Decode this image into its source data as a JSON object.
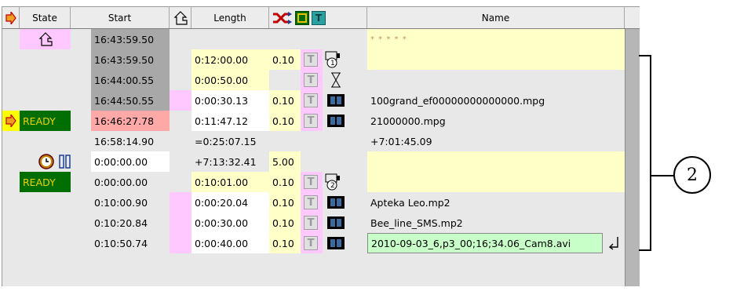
{
  "header": {
    "state": "State",
    "start": "Start",
    "length": "Length",
    "t_label": "T",
    "name": "Name"
  },
  "callout": {
    "label": "2"
  },
  "rows": [
    {
      "state": "",
      "start": "16:43:59.50",
      "length": "",
      "rate": "",
      "name": "* * * * *"
    },
    {
      "state": "",
      "start": "16:43:59.50",
      "length": "0:12:00.00",
      "rate": "0.10",
      "t": "T",
      "badge": "1",
      "name": ""
    },
    {
      "state": "",
      "start": "16:44:00.55",
      "length": "0:00:50.00",
      "rate": "",
      "t": "T",
      "name": ""
    },
    {
      "state": "",
      "start": "16:44:50.55",
      "length": "0:00:30.13",
      "rate": "0.10",
      "t": "T",
      "name": "100grand_ef00000000000000.mpg"
    },
    {
      "state": "READY",
      "start": "16:46:27.78",
      "length": "0:11:47.12",
      "rate": "0.10",
      "t": "T",
      "name": "21000000.mpg"
    },
    {
      "state": "",
      "start": "16:58:14.90",
      "length": "=0:25:07.15",
      "rate": "",
      "name": "+7:01:45.09"
    },
    {
      "state": "",
      "start": "0:00:00.00",
      "length": "+7:13:32.41",
      "rate": "5.00",
      "name": ""
    },
    {
      "state": "READY",
      "start": "0:00:00.00",
      "length": "0:10:01.00",
      "rate": "0.10",
      "t": "T",
      "badge": "2",
      "name": ""
    },
    {
      "state": "",
      "start": "0:10:00.90",
      "length": "0:00:20.04",
      "rate": "0.10",
      "t": "T",
      "name": "Apteka Leo.mp2"
    },
    {
      "state": "",
      "start": "0:10:20.84",
      "length": "0:00:30.00",
      "rate": "0.10",
      "t": "T",
      "name": "Bee_line_SMS.mp2"
    },
    {
      "state": "",
      "start": "0:10:50.74",
      "length": "0:00:40.00",
      "rate": "0.10",
      "t": "T",
      "name": "2010-09-03_6,p3_00;16;34.06_Cam8.avi"
    }
  ]
}
